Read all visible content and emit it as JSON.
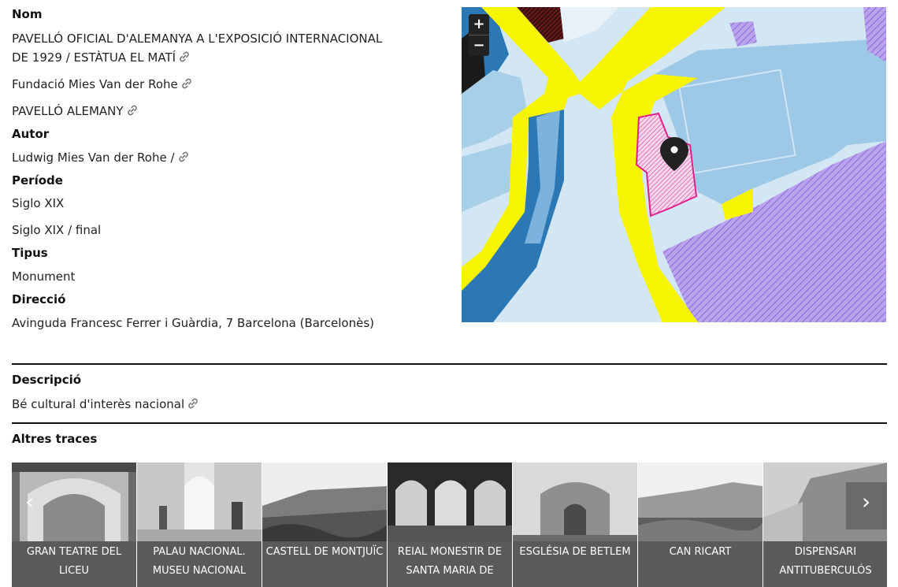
{
  "info": {
    "nom_label": "Nom",
    "nom_lines": [
      "PAVELLÓ OFICIAL D'ALEMANYA A L'EXPOSICIÓ INTERNACIONAL",
      "DE 1929 / ESTÀTUA EL MATÍ"
    ],
    "nom_alt1": "Fundació Mies Van der Rohe",
    "nom_alt2": "PAVELLÓ ALEMANY",
    "autor_label": "Autor",
    "autor_value": "Ludwig Mies Van der Rohe /",
    "periode_label": "Període",
    "periode_value1": "Siglo XIX",
    "periode_value2": "Siglo XIX / final",
    "tipus_label": "Tipus",
    "tipus_value": "Monument",
    "direccio_label": "Direcció",
    "direccio_value": "Avinguda Francesc Ferrer i Guàrdia, 7 Barcelona (Barcelonès)"
  },
  "map": {
    "zoom_in": "+",
    "zoom_out": "−"
  },
  "description": {
    "label": "Descripció",
    "value": "Bé cultural d'interès nacional"
  },
  "others": {
    "label": "Altres traces",
    "prev": "‹",
    "next": "›",
    "cards": [
      {
        "line1": "GRAN TEATRE DEL",
        "line2": "LICEU"
      },
      {
        "line1": "PALAU NACIONAL.",
        "line2": "MUSEU NACIONAL"
      },
      {
        "line1": "CASTELL DE MONTJUÏC",
        "line2": ""
      },
      {
        "line1": "REIAL MONESTIR DE",
        "line2": "SANTA MARIA DE"
      },
      {
        "line1": "ESGLÉSIA DE BETLEM",
        "line2": ""
      },
      {
        "line1": "CAN RICART",
        "line2": ""
      },
      {
        "line1": "DISPENSARI",
        "line2": "ANTITUBERCULÓS"
      }
    ]
  },
  "colors": {
    "map_road": "#f7f400",
    "map_water": "#2b78b4",
    "map_light": "#a8cfe8",
    "map_purple": "#a98be0",
    "map_highlight": "#e0208a"
  }
}
